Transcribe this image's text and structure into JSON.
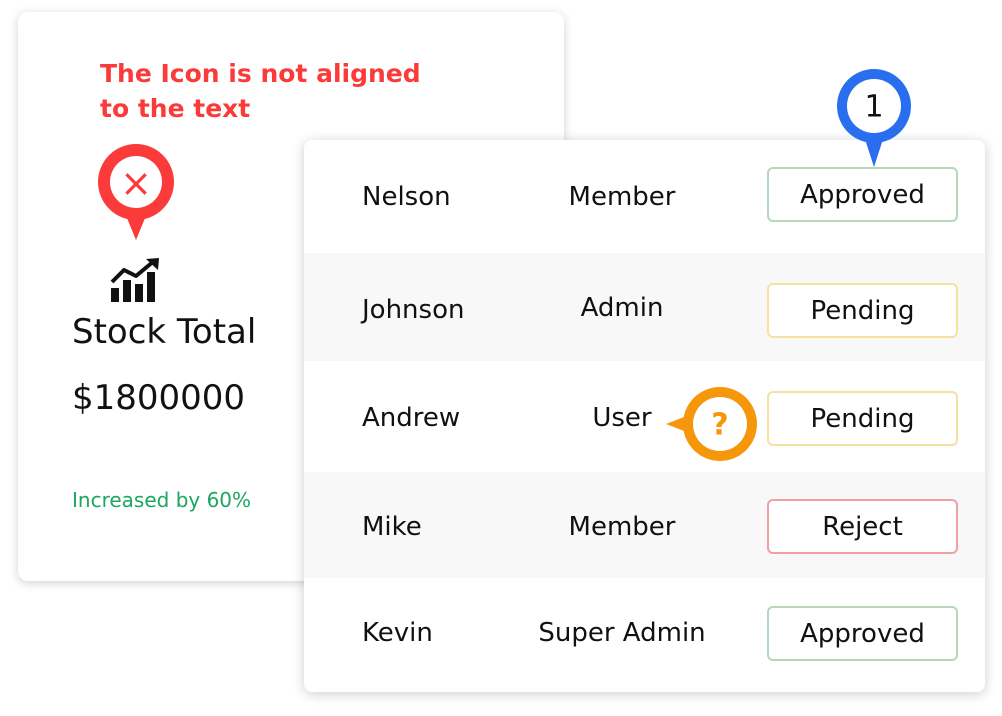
{
  "annotation": {
    "line1": "The Icon is not aligned",
    "line2": "to the text",
    "error_marker": "×",
    "step_marker": "1",
    "question_marker": "?"
  },
  "stock": {
    "title": "Stock Total",
    "value": "$1800000",
    "change": "Increased by 60%",
    "icon": "trending-chart-icon"
  },
  "table": {
    "rows": [
      {
        "name": "Nelson",
        "role": "Member",
        "status": "Approved"
      },
      {
        "name": "Johnson",
        "role": "Admin",
        "status": "Pending"
      },
      {
        "name": "Andrew",
        "role": "User",
        "status": "Pending"
      },
      {
        "name": "Mike",
        "role": "Member",
        "status": "Reject"
      },
      {
        "name": "Kevin",
        "role": "Super Admin",
        "status": "Approved"
      }
    ]
  },
  "colors": {
    "error": "#fb3a3a",
    "step": "#2a6ef0",
    "question": "#f5960b",
    "positive": "#1da65f",
    "approved_border": "#b5d7bc",
    "pending_border": "#f7e1a0",
    "reject_border": "#f0a0a0"
  }
}
